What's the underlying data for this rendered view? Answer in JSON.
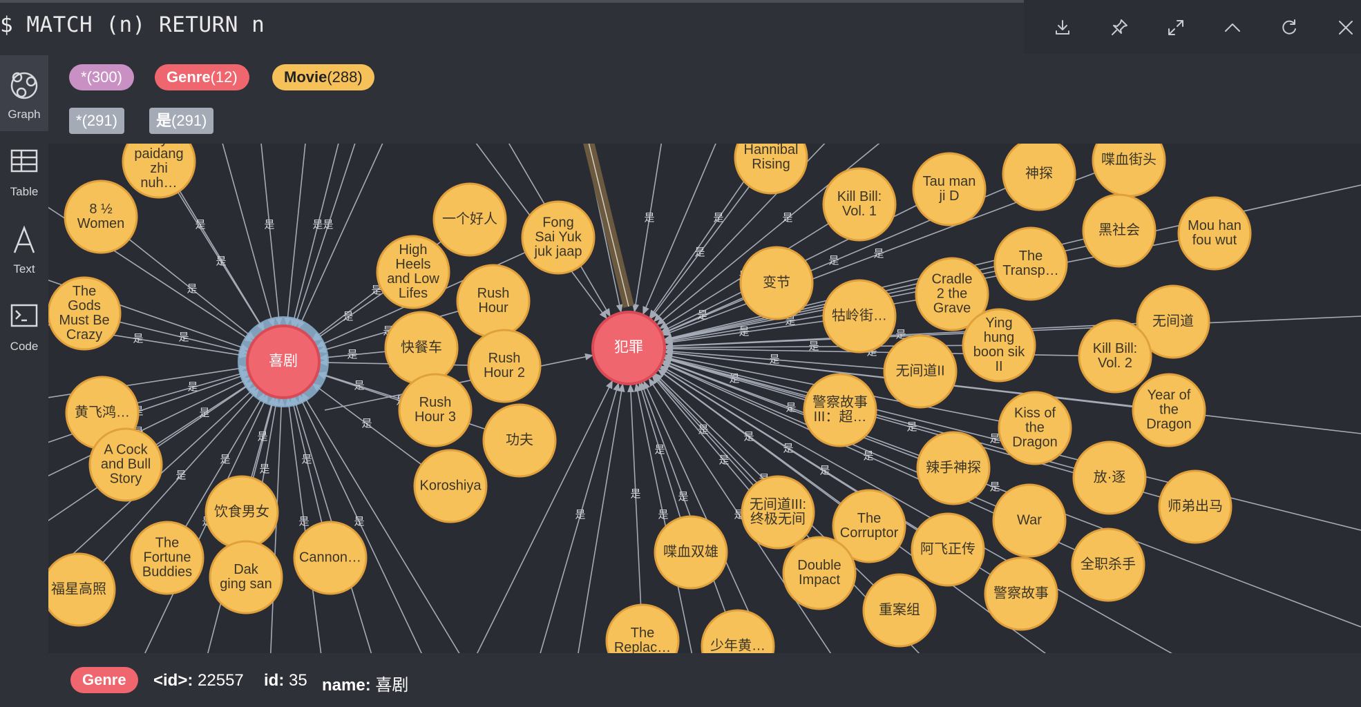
{
  "query": {
    "prompt": "$",
    "text": "MATCH (n) RETURN n"
  },
  "toolbar": {
    "icons": [
      "download-icon",
      "pin-icon",
      "expand-icon",
      "collapse-icon",
      "refresh-icon",
      "close-icon"
    ]
  },
  "sidebar": {
    "items": [
      {
        "label": "Graph",
        "icon": "graph-icon",
        "active": true
      },
      {
        "label": "Table",
        "icon": "table-icon",
        "active": false
      },
      {
        "label": "Text",
        "icon": "text-icon",
        "active": false
      },
      {
        "label": "Code",
        "icon": "code-icon",
        "active": false
      }
    ]
  },
  "legend": {
    "labels": [
      {
        "name": "*",
        "count": "(300)",
        "color": "#c991c3"
      },
      {
        "name": "Genre",
        "count": "(12)",
        "color": "#f0666e"
      },
      {
        "name": "Movie",
        "count": "(288)",
        "color": "#f7c15a"
      }
    ],
    "relationships": [
      {
        "name": "*",
        "count": "(291)"
      },
      {
        "name": "是",
        "count": "(291)"
      }
    ]
  },
  "graph": {
    "edge_label": "是",
    "genres": [
      {
        "id": "g1",
        "name": "喜剧"
      },
      {
        "id": "g2",
        "name": "犯罪"
      }
    ],
    "movies": [
      {
        "name": "Laiya paidang zhi nuh…",
        "lines": [
          "Laiya",
          "paidang",
          "zhi",
          "nuh…"
        ]
      },
      {
        "name": "8 ½ Women",
        "lines": [
          "8 ½",
          "Women"
        ]
      },
      {
        "name": "The Gods Must Be Crazy",
        "lines": [
          "The",
          "Gods",
          "Must Be",
          "Crazy"
        ]
      },
      {
        "name": "黄飞鸿…",
        "lines": [
          "黄飞鸿…"
        ]
      },
      {
        "name": "A Cock and Bull Story",
        "lines": [
          "A Cock",
          "and Bull",
          "Story"
        ]
      },
      {
        "name": "The Fortune Buddies",
        "lines": [
          "The",
          "Fortune",
          "Buddies"
        ]
      },
      {
        "name": "福星高照",
        "lines": [
          "福星高照"
        ]
      },
      {
        "name": "饮食男女",
        "lines": [
          "饮食男女"
        ]
      },
      {
        "name": "Dak ging san",
        "lines": [
          "Dak",
          "ging san"
        ]
      },
      {
        "name": "Cannon…",
        "lines": [
          "Cannon…"
        ]
      },
      {
        "name": "一个好人",
        "lines": [
          "一个好人"
        ]
      },
      {
        "name": "High Heels and Low Lifes",
        "lines": [
          "High",
          "Heels",
          "and Low",
          "Lifes"
        ]
      },
      {
        "name": "Fong Sai Yuk juk jaap",
        "lines": [
          "Fong",
          "Sai Yuk",
          "juk jaap"
        ]
      },
      {
        "name": "Rush Hour",
        "lines": [
          "Rush",
          "Hour"
        ]
      },
      {
        "name": "快餐车",
        "lines": [
          "快餐车"
        ]
      },
      {
        "name": "Rush Hour 2",
        "lines": [
          "Rush",
          "Hour 2"
        ]
      },
      {
        "name": "Rush Hour 3",
        "lines": [
          "Rush",
          "Hour 3"
        ]
      },
      {
        "name": "功夫",
        "lines": [
          "功夫"
        ]
      },
      {
        "name": "Koroshiya",
        "lines": [
          "Koroshiya"
        ]
      },
      {
        "name": "Hannibal Rising",
        "lines": [
          "Hannibal",
          "Rising"
        ]
      },
      {
        "name": "Kill Bill: Vol. 1",
        "lines": [
          "Kill Bill:",
          "Vol. 1"
        ]
      },
      {
        "name": "Tau man ji D",
        "lines": [
          "Tau man",
          "ji D"
        ]
      },
      {
        "name": "神探",
        "lines": [
          "神探"
        ]
      },
      {
        "name": "喋血街头",
        "lines": [
          "喋血街头"
        ]
      },
      {
        "name": "变节",
        "lines": [
          "变节"
        ]
      },
      {
        "name": "Cradle 2 the Grave",
        "lines": [
          "Cradle",
          "2 the",
          "Grave"
        ]
      },
      {
        "name": "The Transp…",
        "lines": [
          "The",
          "Transp…"
        ]
      },
      {
        "name": "黑社会",
        "lines": [
          "黑社会"
        ]
      },
      {
        "name": "Mou han fou wut",
        "lines": [
          "Mou han",
          "fou wut"
        ]
      },
      {
        "name": "牯岭街…",
        "lines": [
          "牯岭街…"
        ]
      },
      {
        "name": "无间道",
        "lines": [
          "无间道"
        ]
      },
      {
        "name": "Ying hung boon sik II",
        "lines": [
          "Ying",
          "hung",
          "boon sik",
          "II"
        ]
      },
      {
        "name": "Kill Bill: Vol. 2",
        "lines": [
          "Kill Bill:",
          "Vol. 2"
        ]
      },
      {
        "name": "无间道II",
        "lines": [
          "无间道II"
        ]
      },
      {
        "name": "警察故事III：超…",
        "lines": [
          "警察故事",
          "III：超…"
        ]
      },
      {
        "name": "Kiss of the Dragon",
        "lines": [
          "Kiss of",
          "the",
          "Dragon"
        ]
      },
      {
        "name": "Year of the Dragon",
        "lines": [
          "Year of",
          "the",
          "Dragon"
        ]
      },
      {
        "name": "辣手神探",
        "lines": [
          "辣手神探"
        ]
      },
      {
        "name": "放·逐",
        "lines": [
          "放·逐"
        ]
      },
      {
        "name": "师弟出马",
        "lines": [
          "师弟出马"
        ]
      },
      {
        "name": "无间道III: 终极无间",
        "lines": [
          "无间道III:",
          "终极无间"
        ]
      },
      {
        "name": "The Corruptor",
        "lines": [
          "The",
          "Corruptor"
        ]
      },
      {
        "name": "War",
        "lines": [
          "War"
        ]
      },
      {
        "name": "喋血双雄",
        "lines": [
          "喋血双雄"
        ]
      },
      {
        "name": "阿飞正传",
        "lines": [
          "阿飞正传"
        ]
      },
      {
        "name": "全职杀手",
        "lines": [
          "全职杀手"
        ]
      },
      {
        "name": "Double Impact",
        "lines": [
          "Double",
          "Impact"
        ]
      },
      {
        "name": "警察故事",
        "lines": [
          "警察故事"
        ]
      },
      {
        "name": "重案组",
        "lines": [
          "重案组"
        ]
      },
      {
        "name": "The Replac…",
        "lines": [
          "The",
          "Replac…"
        ]
      },
      {
        "name": "少年黄…",
        "lines": [
          "少年黄…"
        ]
      }
    ]
  },
  "footer": {
    "badge": "Genre",
    "props": [
      {
        "key": "<id>:",
        "value": "22557"
      },
      {
        "key": "id:",
        "value": "35"
      },
      {
        "key": "name:",
        "value": "喜剧"
      }
    ]
  },
  "colors": {
    "genre": "#f0666e",
    "movie": "#f7c15a",
    "movie_border": "#e0a03c",
    "edge": "#a5abb6",
    "selected_ring": "#8fb4d4"
  }
}
